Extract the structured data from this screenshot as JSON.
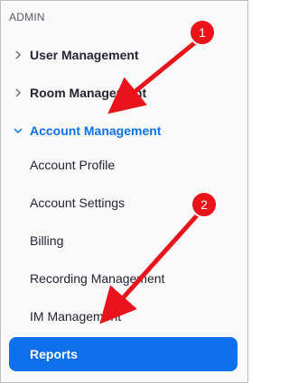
{
  "sidebar": {
    "section_label": "ADMIN",
    "items": [
      {
        "label": "User Management",
        "type": "group",
        "expanded": false
      },
      {
        "label": "Room Management",
        "type": "group",
        "expanded": false
      },
      {
        "label": "Account Management",
        "type": "group",
        "expanded": true
      }
    ],
    "sub_items": [
      {
        "label": "Account Profile"
      },
      {
        "label": "Account Settings"
      },
      {
        "label": "Billing"
      },
      {
        "label": "Recording Management"
      },
      {
        "label": "IM Management"
      }
    ],
    "selected": {
      "label": "Reports"
    }
  },
  "annotations": {
    "step1": "1",
    "step2": "2",
    "arrow_color": "#e8131b"
  },
  "colors": {
    "accent": "#0e71eb",
    "text": "#232333"
  }
}
